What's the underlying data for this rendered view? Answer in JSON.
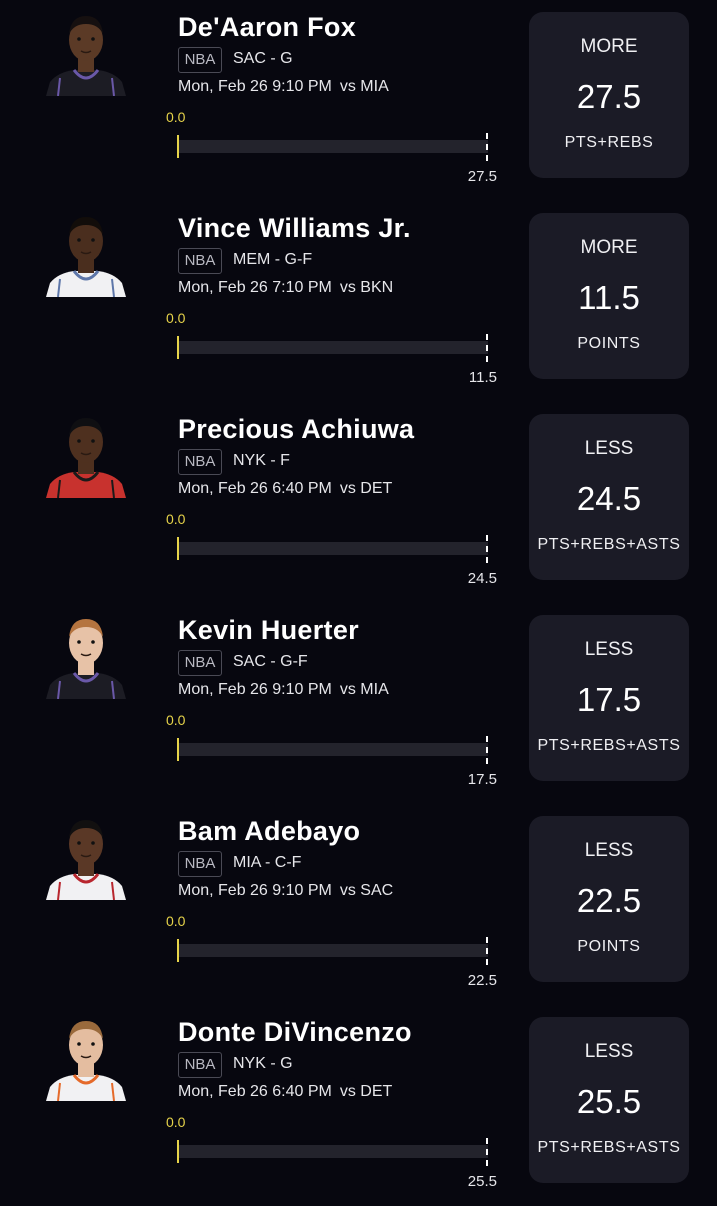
{
  "picks": [
    {
      "name": "De'Aaron Fox",
      "league": "NBA",
      "team_position": "SAC - G",
      "game_time": "Mon, Feb 26 9:10 PM",
      "opponent": "vs MIA",
      "current_value": "0.0",
      "progress_fraction": 0,
      "target_value": "27.5",
      "choice": "MORE",
      "line": "27.5",
      "stat": "PTS+REBS",
      "avatar": {
        "skin": "#5b3a26",
        "hair": "#161010",
        "jersey": "#1c1c24",
        "trim": "#6a58a8"
      }
    },
    {
      "name": "Vince Williams Jr.",
      "league": "NBA",
      "team_position": "MEM - G-F",
      "game_time": "Mon, Feb 26 7:10 PM",
      "opponent": "vs BKN",
      "current_value": "0.0",
      "progress_fraction": 0,
      "target_value": "11.5",
      "choice": "MORE",
      "line": "11.5",
      "stat": "POINTS",
      "avatar": {
        "skin": "#4a2e1e",
        "hair": "#120d0a",
        "jersey": "#f1f1f3",
        "trim": "#5d76a9"
      }
    },
    {
      "name": "Precious Achiuwa",
      "league": "NBA",
      "team_position": "NYK - F",
      "game_time": "Mon, Feb 26 6:40 PM",
      "opponent": "vs DET",
      "current_value": "0.0",
      "progress_fraction": 0,
      "target_value": "24.5",
      "choice": "LESS",
      "line": "24.5",
      "stat": "PTS+REBS+ASTS",
      "avatar": {
        "skin": "#4e301f",
        "hair": "#0f0f12",
        "jersey": "#c8322e",
        "trim": "#1a1a1a"
      }
    },
    {
      "name": "Kevin Huerter",
      "league": "NBA",
      "team_position": "SAC - G-F",
      "game_time": "Mon, Feb 26 9:10 PM",
      "opponent": "vs MIA",
      "current_value": "0.0",
      "progress_fraction": 0,
      "target_value": "17.5",
      "choice": "LESS",
      "line": "17.5",
      "stat": "PTS+REBS+ASTS",
      "avatar": {
        "skin": "#e7c2a7",
        "hair": "#b5743f",
        "jersey": "#1c1c24",
        "trim": "#6a58a8"
      }
    },
    {
      "name": "Bam Adebayo",
      "league": "NBA",
      "team_position": "MIA - C-F",
      "game_time": "Mon, Feb 26 9:10 PM",
      "opponent": "vs SAC",
      "current_value": "0.0",
      "progress_fraction": 0,
      "target_value": "22.5",
      "choice": "LESS",
      "line": "22.5",
      "stat": "POINTS",
      "avatar": {
        "skin": "#5a3826",
        "hair": "#121010",
        "jersey": "#f1f1f3",
        "trim": "#b8262e"
      }
    },
    {
      "name": "Donte DiVincenzo",
      "league": "NBA",
      "team_position": "NYK - G",
      "game_time": "Mon, Feb 26 6:40 PM",
      "opponent": "vs DET",
      "current_value": "0.0",
      "progress_fraction": 0,
      "target_value": "25.5",
      "choice": "LESS",
      "line": "25.5",
      "stat": "PTS+REBS+ASTS",
      "avatar": {
        "skin": "#e4bda0",
        "hair": "#9a6a3c",
        "jersey": "#f1f1f3",
        "trim": "#e56a2a"
      }
    }
  ]
}
